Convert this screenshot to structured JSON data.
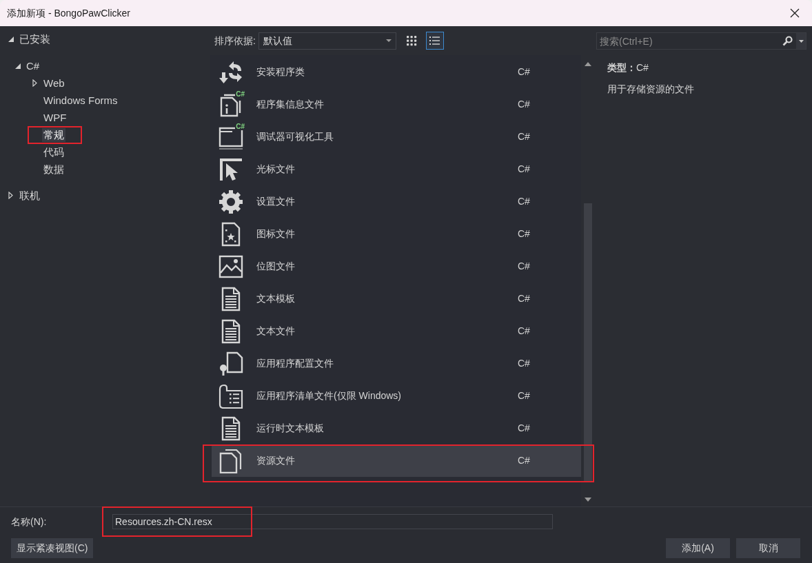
{
  "window": {
    "title": "添加新项 - BongoPawClicker"
  },
  "tree": [
    {
      "label": "已安装",
      "expanded": true,
      "selected": false,
      "highlighted": false,
      "children": [
        {
          "label": "C#",
          "expanded": true,
          "selected": false,
          "highlighted": false,
          "children": [
            {
              "label": "Web",
              "expanded": false,
              "selected": false,
              "highlighted": false
            },
            {
              "label": "Windows Forms",
              "selected": false,
              "highlighted": false
            },
            {
              "label": "WPF",
              "selected": false,
              "highlighted": false
            },
            {
              "label": "常规",
              "selected": true,
              "highlighted": true
            },
            {
              "label": "代码",
              "selected": false,
              "highlighted": false
            },
            {
              "label": "数据",
              "selected": false,
              "highlighted": false
            }
          ]
        }
      ]
    },
    {
      "label": "联机",
      "expanded": false,
      "selected": false,
      "highlighted": false
    }
  ],
  "sort": {
    "label": "排序依据:",
    "value": "默认值"
  },
  "view_modes": [
    {
      "kind": "grid",
      "selected": false
    },
    {
      "kind": "list",
      "selected": true
    }
  ],
  "templates": [
    {
      "kind": "installer",
      "name": "安装程序类",
      "language": "C#",
      "selected": false,
      "highlighted": false
    },
    {
      "kind": "info",
      "badge": "C#",
      "name": "程序集信息文件",
      "language": "C#",
      "selected": false,
      "highlighted": false
    },
    {
      "kind": "visualizer",
      "badge": "C#",
      "name": "调试器可视化工具",
      "language": "C#",
      "selected": false,
      "highlighted": false
    },
    {
      "kind": "cursor",
      "name": "光标文件",
      "language": "C#",
      "selected": false,
      "highlighted": false
    },
    {
      "kind": "settings",
      "name": "设置文件",
      "language": "C#",
      "selected": false,
      "highlighted": false
    },
    {
      "kind": "iconfile",
      "name": "图标文件",
      "language": "C#",
      "selected": false,
      "highlighted": false
    },
    {
      "kind": "bitmap",
      "name": "位图文件",
      "language": "C#",
      "selected": false,
      "highlighted": false
    },
    {
      "kind": "document",
      "name": "文本模板",
      "language": "C#",
      "selected": false,
      "highlighted": false
    },
    {
      "kind": "document",
      "name": "文本文件",
      "language": "C#",
      "selected": false,
      "highlighted": false
    },
    {
      "kind": "config",
      "name": "应用程序配置文件",
      "language": "C#",
      "selected": false,
      "highlighted": false
    },
    {
      "kind": "manifest",
      "name": "应用程序清单文件(仅限 Windows)",
      "language": "C#",
      "selected": false,
      "highlighted": false
    },
    {
      "kind": "document",
      "name": "运行时文本模板",
      "language": "C#",
      "selected": false,
      "highlighted": false
    },
    {
      "kind": "resource",
      "name": "资源文件",
      "language": "C#",
      "selected": true,
      "highlighted": true
    }
  ],
  "search": {
    "placeholder": "搜索(Ctrl+E)"
  },
  "details": {
    "type_label": "类型：",
    "type_value": "C#",
    "description": "用于存储资源的文件"
  },
  "name_field": {
    "label": "名称(N):",
    "value": "Resources.zh-CN.resx",
    "highlighted": true
  },
  "compact_view_button": "显示紧凑视图(C)",
  "buttons": [
    "添加(A)",
    "取消"
  ]
}
